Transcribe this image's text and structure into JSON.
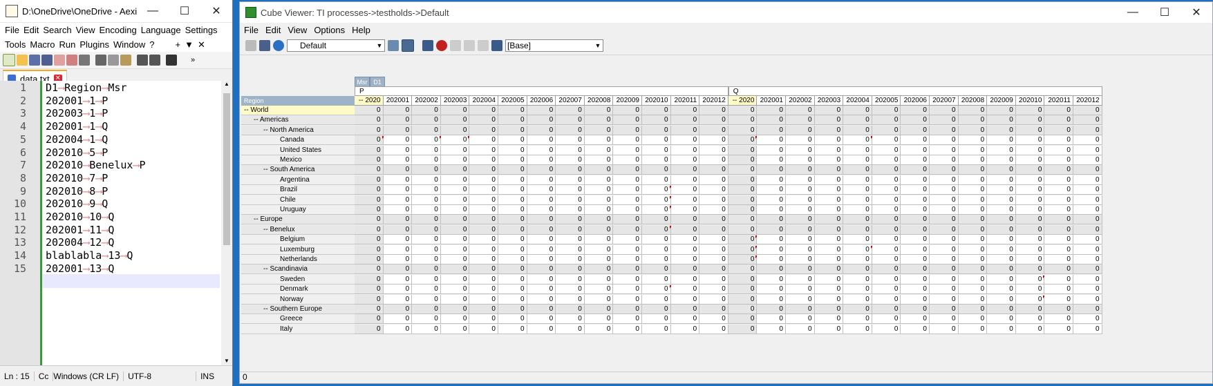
{
  "npp": {
    "title": "D:\\OneDrive\\OneDrive - Aexis...",
    "menu_row1": [
      "File",
      "Edit",
      "Search",
      "View",
      "Encoding",
      "Language",
      "Settings"
    ],
    "menu_row2": [
      "Tools",
      "Macro",
      "Run",
      "Plugins",
      "Window",
      "?"
    ],
    "menu_extra": [
      "+",
      "▼",
      "✕"
    ],
    "tab_label": "data.txt",
    "lines": [
      [
        "D1",
        "Region",
        "Msr"
      ],
      [
        "202001",
        "1",
        "P"
      ],
      [
        "202003",
        "1",
        "P"
      ],
      [
        "202001",
        "1",
        "Q"
      ],
      [
        "202004",
        "1",
        "Q"
      ],
      [
        "202010",
        "5",
        "P"
      ],
      [
        "202010",
        "Benelux",
        "P"
      ],
      [
        "202010",
        "7",
        "P"
      ],
      [
        "202010",
        "8",
        "P"
      ],
      [
        "202010",
        "9",
        "Q"
      ],
      [
        "202010",
        "10",
        "Q"
      ],
      [
        "202001",
        "11",
        "Q"
      ],
      [
        "202004",
        "12",
        "Q"
      ],
      [
        "blablabla",
        "13",
        "Q"
      ],
      [
        "202001",
        "13",
        "Q"
      ]
    ],
    "status": {
      "pos": "Ln : 15",
      "col": "Cc",
      "eol": "Windows (CR LF)",
      "enc": "UTF-8",
      "mode": "INS"
    }
  },
  "cv": {
    "title": "Cube Viewer: TI processes->testholds->Default",
    "menu": [
      "File",
      "Edit",
      "View",
      "Options",
      "Help"
    ],
    "view_combo": "Default",
    "subset_combo": "[Base]",
    "chips": [
      "Msr",
      "D1"
    ],
    "region_label": "Region",
    "measures": [
      "P",
      "Q"
    ],
    "columns": [
      "-- 2020",
      "202001",
      "202002",
      "202003",
      "202004",
      "202005",
      "202006",
      "202007",
      "202008",
      "202009",
      "202010",
      "202011",
      "202012"
    ],
    "rows": [
      {
        "label": "-- World",
        "level": 0,
        "cons": true
      },
      {
        "label": "-- Americas",
        "level": 1,
        "cons": true
      },
      {
        "label": "-- North America",
        "level": 2,
        "cons": true
      },
      {
        "label": "Canada",
        "level": 3,
        "cons": false
      },
      {
        "label": "United States",
        "level": 3,
        "cons": false
      },
      {
        "label": "Mexico",
        "level": 3,
        "cons": false
      },
      {
        "label": "-- South America",
        "level": 2,
        "cons": true
      },
      {
        "label": "Argentina",
        "level": 3,
        "cons": false
      },
      {
        "label": "Brazil",
        "level": 3,
        "cons": false
      },
      {
        "label": "Chile",
        "level": 3,
        "cons": false
      },
      {
        "label": "Uruguay",
        "level": 3,
        "cons": false
      },
      {
        "label": "-- Europe",
        "level": 1,
        "cons": true
      },
      {
        "label": "-- Benelux",
        "level": 2,
        "cons": true
      },
      {
        "label": "Belgium",
        "level": 3,
        "cons": false
      },
      {
        "label": "Luxemburg",
        "level": 3,
        "cons": false
      },
      {
        "label": "Netherlands",
        "level": 3,
        "cons": false
      },
      {
        "label": "-- Scandinavia",
        "level": 2,
        "cons": true
      },
      {
        "label": "Sweden",
        "level": 3,
        "cons": false
      },
      {
        "label": "Denmark",
        "level": 3,
        "cons": false
      },
      {
        "label": "Norway",
        "level": 3,
        "cons": false
      },
      {
        "label": "-- Southern Europe",
        "level": 2,
        "cons": true
      },
      {
        "label": "Greece",
        "level": 3,
        "cons": false
      },
      {
        "label": "Italy",
        "level": 3,
        "cons": false
      }
    ],
    "cell_value": "0",
    "flags": [
      [
        3,
        0
      ],
      [
        3,
        2
      ],
      [
        3,
        3
      ],
      [
        3,
        13
      ],
      [
        3,
        17
      ],
      [
        8,
        10
      ],
      [
        9,
        10
      ],
      [
        10,
        10
      ],
      [
        12,
        10
      ],
      [
        13,
        13
      ],
      [
        14,
        13
      ],
      [
        14,
        17
      ],
      [
        15,
        13
      ],
      [
        17,
        23
      ],
      [
        18,
        10
      ],
      [
        19,
        23
      ]
    ],
    "status_value": "0"
  }
}
